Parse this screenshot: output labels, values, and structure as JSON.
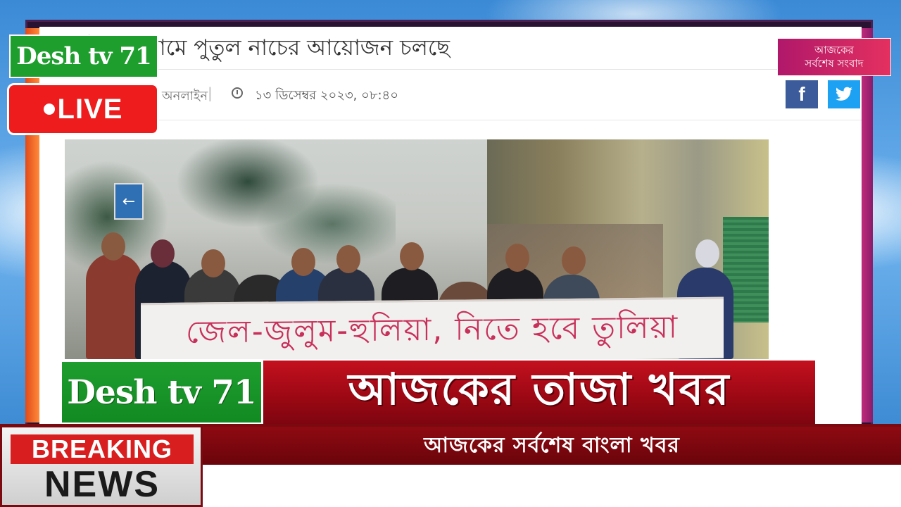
{
  "article": {
    "headline": "নির্বাচনের নামে পুতুল নাচের আয়োজন চলছে",
    "author": "অনলাইন",
    "separator": "|",
    "date": "১৩ ডিসেম্বর ২০২৩, ০৮:৪০",
    "banner_text": "জেল-জুলুম-হুলিয়া, নিতে হবে তুলিয়া",
    "sign_glyph": "←"
  },
  "social": {
    "facebook": "f",
    "twitter": "🐦"
  },
  "badge_top_right": {
    "line1": "আজকের",
    "line2": "সর্বশেষ সংবাদ"
  },
  "channel": {
    "logo": "Desh tv 71",
    "live": "LIVE"
  },
  "lower_third": {
    "logo": "Desh tv 71",
    "title": "আজকের তাজা খবর"
  },
  "breaking": {
    "word1": "BREAKING",
    "word2": "NEWS",
    "ticker": "আজকের সর্বশেষ বাংলা খবর"
  },
  "colors": {
    "logo_green": "#1d9e2d",
    "live_red": "#ee1c1c",
    "title_red": "#c4101e",
    "ticker_red": "#8f0a12"
  }
}
